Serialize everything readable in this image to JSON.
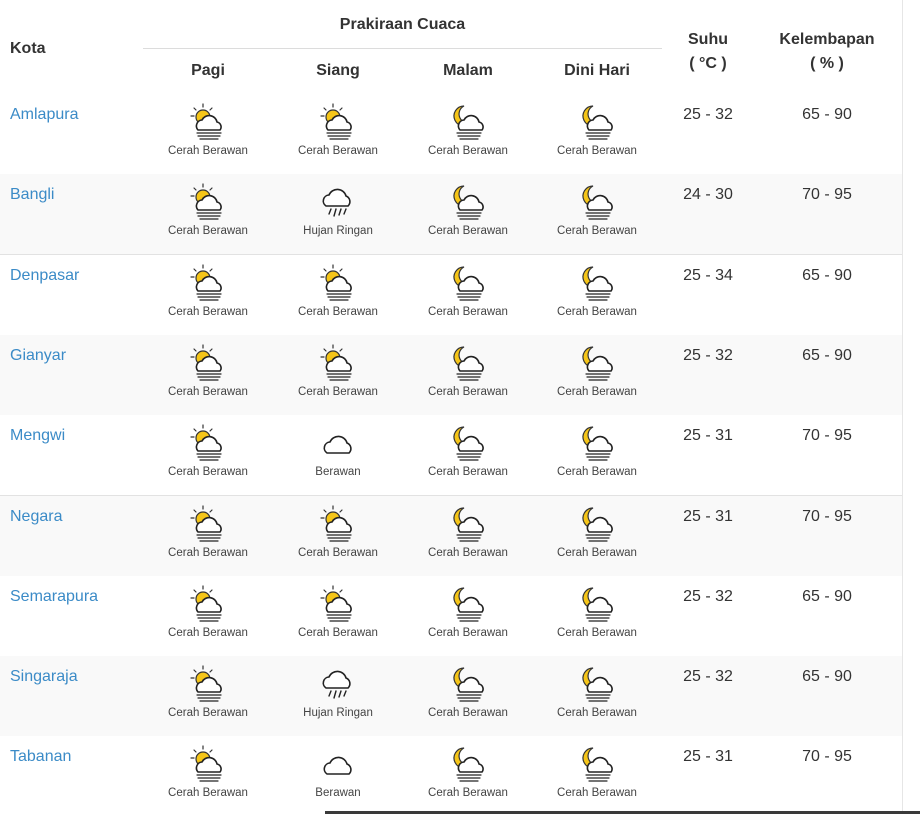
{
  "header": {
    "city": "Kota",
    "forecast_group": "Prakiraan Cuaca",
    "periods": [
      "Pagi",
      "Siang",
      "Malam",
      "Dini Hari"
    ],
    "temp": "Suhu",
    "temp_unit": "( °C )",
    "humidity": "Kelembapan",
    "humidity_unit": "( % )"
  },
  "rows": [
    {
      "city": "Amlapura",
      "forecast": [
        {
          "icon": "sun-cloud-icon",
          "label": "Cerah Berawan"
        },
        {
          "icon": "sun-cloud-icon",
          "label": "Cerah Berawan"
        },
        {
          "icon": "moon-cloud-icon",
          "label": "Cerah Berawan"
        },
        {
          "icon": "moon-cloud-icon",
          "label": "Cerah Berawan"
        }
      ],
      "temp": "25 - 32",
      "humidity": "65 - 90"
    },
    {
      "city": "Bangli",
      "forecast": [
        {
          "icon": "sun-cloud-icon",
          "label": "Cerah Berawan"
        },
        {
          "icon": "rain-cloud-icon",
          "label": "Hujan Ringan"
        },
        {
          "icon": "moon-cloud-icon",
          "label": "Cerah Berawan"
        },
        {
          "icon": "moon-cloud-icon",
          "label": "Cerah Berawan"
        }
      ],
      "temp": "24 - 30",
      "humidity": "70 - 95"
    },
    {
      "city": "Denpasar",
      "forecast": [
        {
          "icon": "sun-cloud-icon",
          "label": "Cerah Berawan"
        },
        {
          "icon": "sun-cloud-icon",
          "label": "Cerah Berawan"
        },
        {
          "icon": "moon-cloud-icon",
          "label": "Cerah Berawan"
        },
        {
          "icon": "moon-cloud-icon",
          "label": "Cerah Berawan"
        }
      ],
      "temp": "25 - 34",
      "humidity": "65 - 90"
    },
    {
      "city": "Gianyar",
      "forecast": [
        {
          "icon": "sun-cloud-icon",
          "label": "Cerah Berawan"
        },
        {
          "icon": "sun-cloud-icon",
          "label": "Cerah Berawan"
        },
        {
          "icon": "moon-cloud-icon",
          "label": "Cerah Berawan"
        },
        {
          "icon": "moon-cloud-icon",
          "label": "Cerah Berawan"
        }
      ],
      "temp": "25 - 32",
      "humidity": "65 - 90"
    },
    {
      "city": "Mengwi",
      "forecast": [
        {
          "icon": "sun-cloud-icon",
          "label": "Cerah Berawan"
        },
        {
          "icon": "cloud-icon",
          "label": "Berawan"
        },
        {
          "icon": "moon-cloud-icon",
          "label": "Cerah Berawan"
        },
        {
          "icon": "moon-cloud-icon",
          "label": "Cerah Berawan"
        }
      ],
      "temp": "25 - 31",
      "humidity": "70 - 95"
    },
    {
      "city": "Negara",
      "forecast": [
        {
          "icon": "sun-cloud-icon",
          "label": "Cerah Berawan"
        },
        {
          "icon": "sun-cloud-icon",
          "label": "Cerah Berawan"
        },
        {
          "icon": "moon-cloud-icon",
          "label": "Cerah Berawan"
        },
        {
          "icon": "moon-cloud-icon",
          "label": "Cerah Berawan"
        }
      ],
      "temp": "25 - 31",
      "humidity": "70 - 95"
    },
    {
      "city": "Semarapura",
      "forecast": [
        {
          "icon": "sun-cloud-icon",
          "label": "Cerah Berawan"
        },
        {
          "icon": "sun-cloud-icon",
          "label": "Cerah Berawan"
        },
        {
          "icon": "moon-cloud-icon",
          "label": "Cerah Berawan"
        },
        {
          "icon": "moon-cloud-icon",
          "label": "Cerah Berawan"
        }
      ],
      "temp": "25 - 32",
      "humidity": "65 - 90"
    },
    {
      "city": "Singaraja",
      "forecast": [
        {
          "icon": "sun-cloud-icon",
          "label": "Cerah Berawan"
        },
        {
          "icon": "rain-cloud-icon",
          "label": "Hujan Ringan"
        },
        {
          "icon": "moon-cloud-icon",
          "label": "Cerah Berawan"
        },
        {
          "icon": "moon-cloud-icon",
          "label": "Cerah Berawan"
        }
      ],
      "temp": "25 - 32",
      "humidity": "65 - 90"
    },
    {
      "city": "Tabanan",
      "forecast": [
        {
          "icon": "sun-cloud-icon",
          "label": "Cerah Berawan"
        },
        {
          "icon": "cloud-icon",
          "label": "Berawan"
        },
        {
          "icon": "moon-cloud-icon",
          "label": "Cerah Berawan"
        },
        {
          "icon": "moon-cloud-icon",
          "label": "Cerah Berawan"
        }
      ],
      "temp": "25 - 31",
      "humidity": "70 - 95"
    }
  ],
  "colors": {
    "link": "#3b8bc7",
    "sun": "#f5c518",
    "cloud_stroke": "#222222",
    "row_alt": "#f9f9f9"
  }
}
